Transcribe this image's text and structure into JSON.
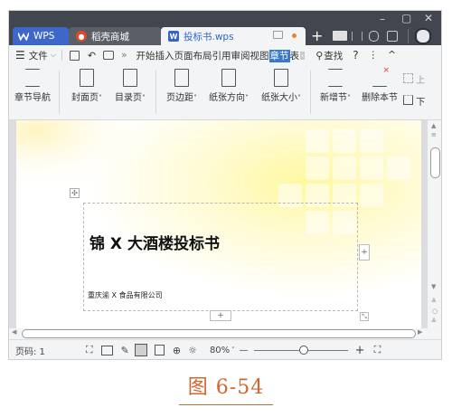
{
  "window": {
    "tabs": [
      {
        "label": "WPS",
        "icon": "wps-logo-icon"
      },
      {
        "label": "稻壳商城",
        "icon": "docer-icon"
      },
      {
        "label": "投标书.wps",
        "icon": "writer-doc-icon"
      }
    ],
    "add_tab": "+",
    "controls": {
      "minimize": "–",
      "maximize": "▢",
      "close": "✕"
    }
  },
  "menu": {
    "file_label": "文件",
    "tabs": [
      "开始",
      "插入",
      "页面布局",
      "引用",
      "审阅",
      "视图",
      "章节",
      "表"
    ],
    "active_tab": "章节",
    "search_label": "查找",
    "help": "?",
    "more": "⋮",
    "collapse": "^"
  },
  "ribbon": {
    "buttons": [
      {
        "label": "章节导航",
        "dropdown": false
      },
      {
        "label": "封面页",
        "dropdown": true
      },
      {
        "label": "目录页",
        "dropdown": true
      },
      {
        "label": "页边距",
        "dropdown": true
      },
      {
        "label": "纸张方向",
        "dropdown": true
      },
      {
        "label": "纸张大小",
        "dropdown": true
      },
      {
        "label": "新增节",
        "dropdown": true
      },
      {
        "label": "删除本节",
        "dropdown": false
      }
    ],
    "side_labels": [
      "上",
      "下"
    ]
  },
  "document": {
    "title": "锦 X 大酒楼投标书",
    "company": "重庆渝 X 食品有限公司",
    "add_row": "+",
    "add_col": "+"
  },
  "status": {
    "page_label": "页码: 1",
    "zoom": "80%",
    "zoom_minus": "—",
    "zoom_plus": "+",
    "zoom_level": 0.52
  },
  "caption": "图 6-54",
  "colors": {
    "titlebar": "#41464f",
    "active_tab_accent": "#3464c8",
    "highlight_tab": "#3a78c9",
    "caption": "#d0672d",
    "wps_red": "#e8462c"
  }
}
